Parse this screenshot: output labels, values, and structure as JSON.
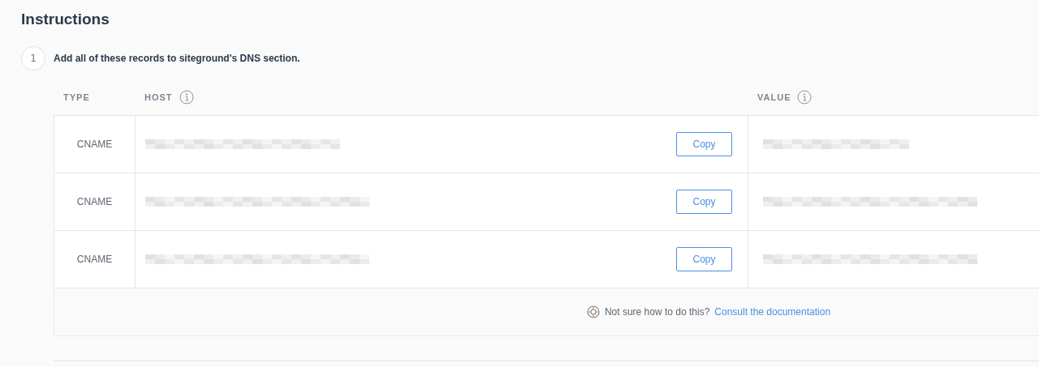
{
  "title": "Instructions",
  "step": {
    "number": "1",
    "text": "Add all of these records to siteground's DNS section."
  },
  "table": {
    "columns": [
      "TYPE",
      "HOST",
      "VALUE"
    ],
    "rows": [
      {
        "type": "CNAME",
        "copy_label": "Copy"
      },
      {
        "type": "CNAME",
        "copy_label": "Copy"
      },
      {
        "type": "CNAME",
        "copy_label": "Copy"
      }
    ]
  },
  "help": {
    "text": "Not sure how to do this?",
    "link": "Consult the documentation"
  }
}
